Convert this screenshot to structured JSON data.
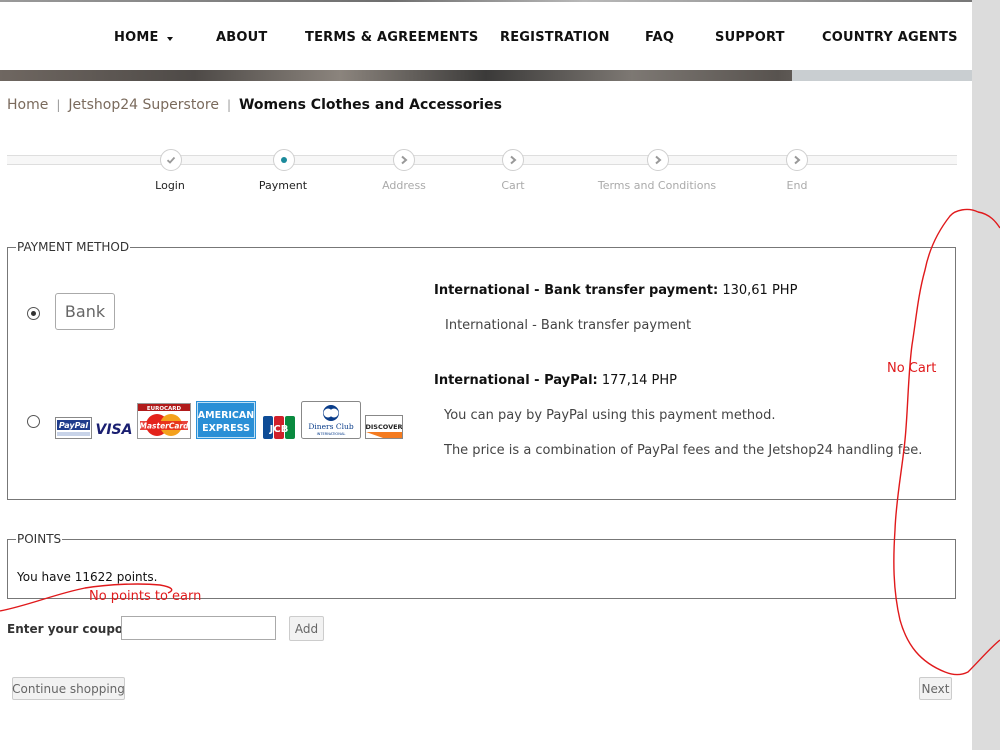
{
  "nav": {
    "items": [
      {
        "label": "HOME"
      },
      {
        "label": "ABOUT"
      },
      {
        "label": "TERMS & AGREEMENTS"
      },
      {
        "label": "REGISTRATION"
      },
      {
        "label": "FAQ"
      },
      {
        "label": "SUPPORT"
      },
      {
        "label": "COUNTRY AGENTS"
      }
    ]
  },
  "breadcrumb": {
    "home": "Home",
    "store": "Jetshop24 Superstore",
    "current": "Womens Clothes and Accessories"
  },
  "steps": [
    {
      "label": "Login",
      "state": "done"
    },
    {
      "label": "Payment",
      "state": "current"
    },
    {
      "label": "Address",
      "state": "pending"
    },
    {
      "label": "Cart",
      "state": "pending"
    },
    {
      "label": "Terms and Conditions",
      "state": "pending"
    },
    {
      "label": "End",
      "state": "pending"
    }
  ],
  "payment": {
    "legend": "PAYMENT METHOD",
    "methods": [
      {
        "logo_text": "Bank",
        "title": "International - Bank transfer payment:",
        "price": "130,61 PHP",
        "description": [
          "International - Bank transfer payment"
        ],
        "selected": true
      },
      {
        "title": "International - PayPal:",
        "price": "177,14 PHP",
        "description": [
          "You can pay by PayPal using this payment method.",
          "The price is a combination of PayPal fees and the Jetshop24 handling fee."
        ],
        "selected": false,
        "card_logos": {
          "paypal": "PayPal",
          "visa": "VISA",
          "mastercard_top": "EUROCARD",
          "mastercard": "MasterCard",
          "amex_1": "AMERICAN",
          "amex_2": "EXPRESS",
          "jcb": "JCB",
          "diners_1": "Diners Club",
          "diners_2": "INTERNATIONAL",
          "discover": "DISCOVER"
        }
      }
    ]
  },
  "points": {
    "legend": "POINTS",
    "text": "You have 11622 points."
  },
  "coupon": {
    "label": "Enter your coupon",
    "value": "",
    "add_label": "Add"
  },
  "buttons": {
    "continue": "Continue shopping",
    "next": "Next"
  },
  "annotations": {
    "no_cart": "No Cart",
    "no_points": "No points to earn"
  },
  "colors": {
    "annotation": "#e0191b",
    "step_current": "#1b8a9b",
    "breadcrumb_link": "#7a6a5c"
  }
}
